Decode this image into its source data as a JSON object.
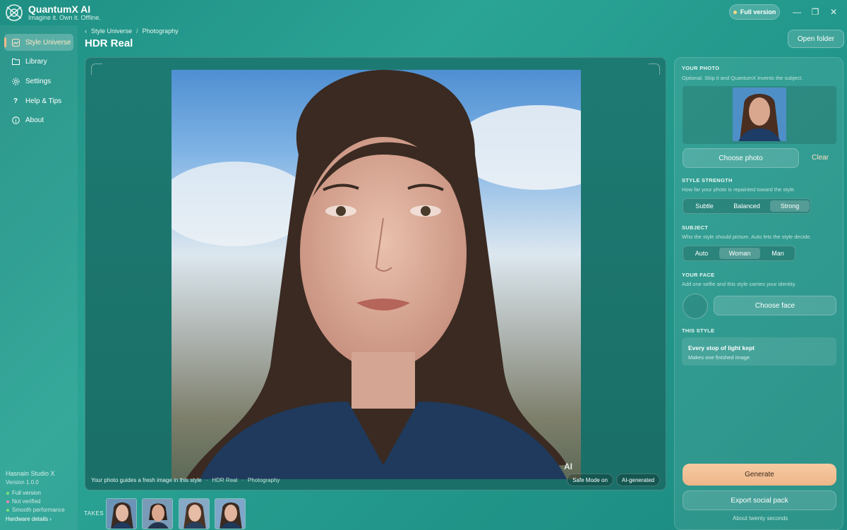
{
  "app": {
    "name": "QuantumX AI",
    "tagline": "Imagine it. Own it. Offline.",
    "full_version_pill": "Full version"
  },
  "window_controls": {
    "minimize": "—",
    "restore": "❐",
    "close": "✕"
  },
  "sidebar": {
    "items": [
      {
        "label": "Style Universe",
        "icon": "style-universe-icon",
        "active": true
      },
      {
        "label": "Library",
        "icon": "folder-icon",
        "active": false
      },
      {
        "label": "Settings",
        "icon": "gear-icon",
        "active": false
      },
      {
        "label": "Help & Tips",
        "icon": "question-icon",
        "active": false
      },
      {
        "label": "About",
        "icon": "info-icon",
        "active": false
      }
    ],
    "studio": "Hasnain Studio X",
    "version": "Version 1.0.0",
    "statuses": [
      {
        "label": "Full version",
        "color": "#7ee07a"
      },
      {
        "label": "Not verified",
        "color": "#e58ab3"
      },
      {
        "label": "Smooth performance",
        "color": "#7ee07a"
      }
    ],
    "hardware_link": "Hardware details ›"
  },
  "header": {
    "breadcrumb": [
      "Style Universe",
      "Photography"
    ],
    "breadcrumb_back": "‹",
    "breadcrumb_sep": "/",
    "title": "HDR Real",
    "open_folder": "Open folder"
  },
  "canvas": {
    "ai_mark": "AI",
    "caption": "Your photo guides a fresh image in this style",
    "caption_style": "HDR Real",
    "caption_sep": "·",
    "caption_category": "Photography",
    "safe_mode": "Safe Mode on",
    "ai_badge": "AI-generated"
  },
  "takes": {
    "label": "TAKES",
    "count": 4
  },
  "panel": {
    "your_photo": {
      "title": "YOUR PHOTO",
      "desc": "Optional. Skip it and QuantumX invents the subject.",
      "choose": "Choose photo",
      "clear": "Clear"
    },
    "strength": {
      "title": "STYLE STRENGTH",
      "desc": "How far your photo is repainted toward the style.",
      "options": [
        "Subtle",
        "Balanced",
        "Strong"
      ],
      "selected": "Strong"
    },
    "subject": {
      "title": "SUBJECT",
      "desc": "Who the style should picture. Auto lets the style decide.",
      "options": [
        "Auto",
        "Woman",
        "Man"
      ],
      "selected": "Woman"
    },
    "face": {
      "title": "YOUR FACE",
      "desc": "Add one selfie and this style carries your identity.",
      "choose": "Choose face"
    },
    "this_style": {
      "title": "THIS STYLE",
      "card_title": "Every stop of light kept",
      "card_sub": "Makes one finished image"
    },
    "generate": "Generate",
    "export": "Export social pack",
    "eta": "About twenty seconds"
  },
  "colors": {
    "accent_active": "#ffe6c4",
    "generate_bg": "#f2c095",
    "bg": "#23988c"
  }
}
